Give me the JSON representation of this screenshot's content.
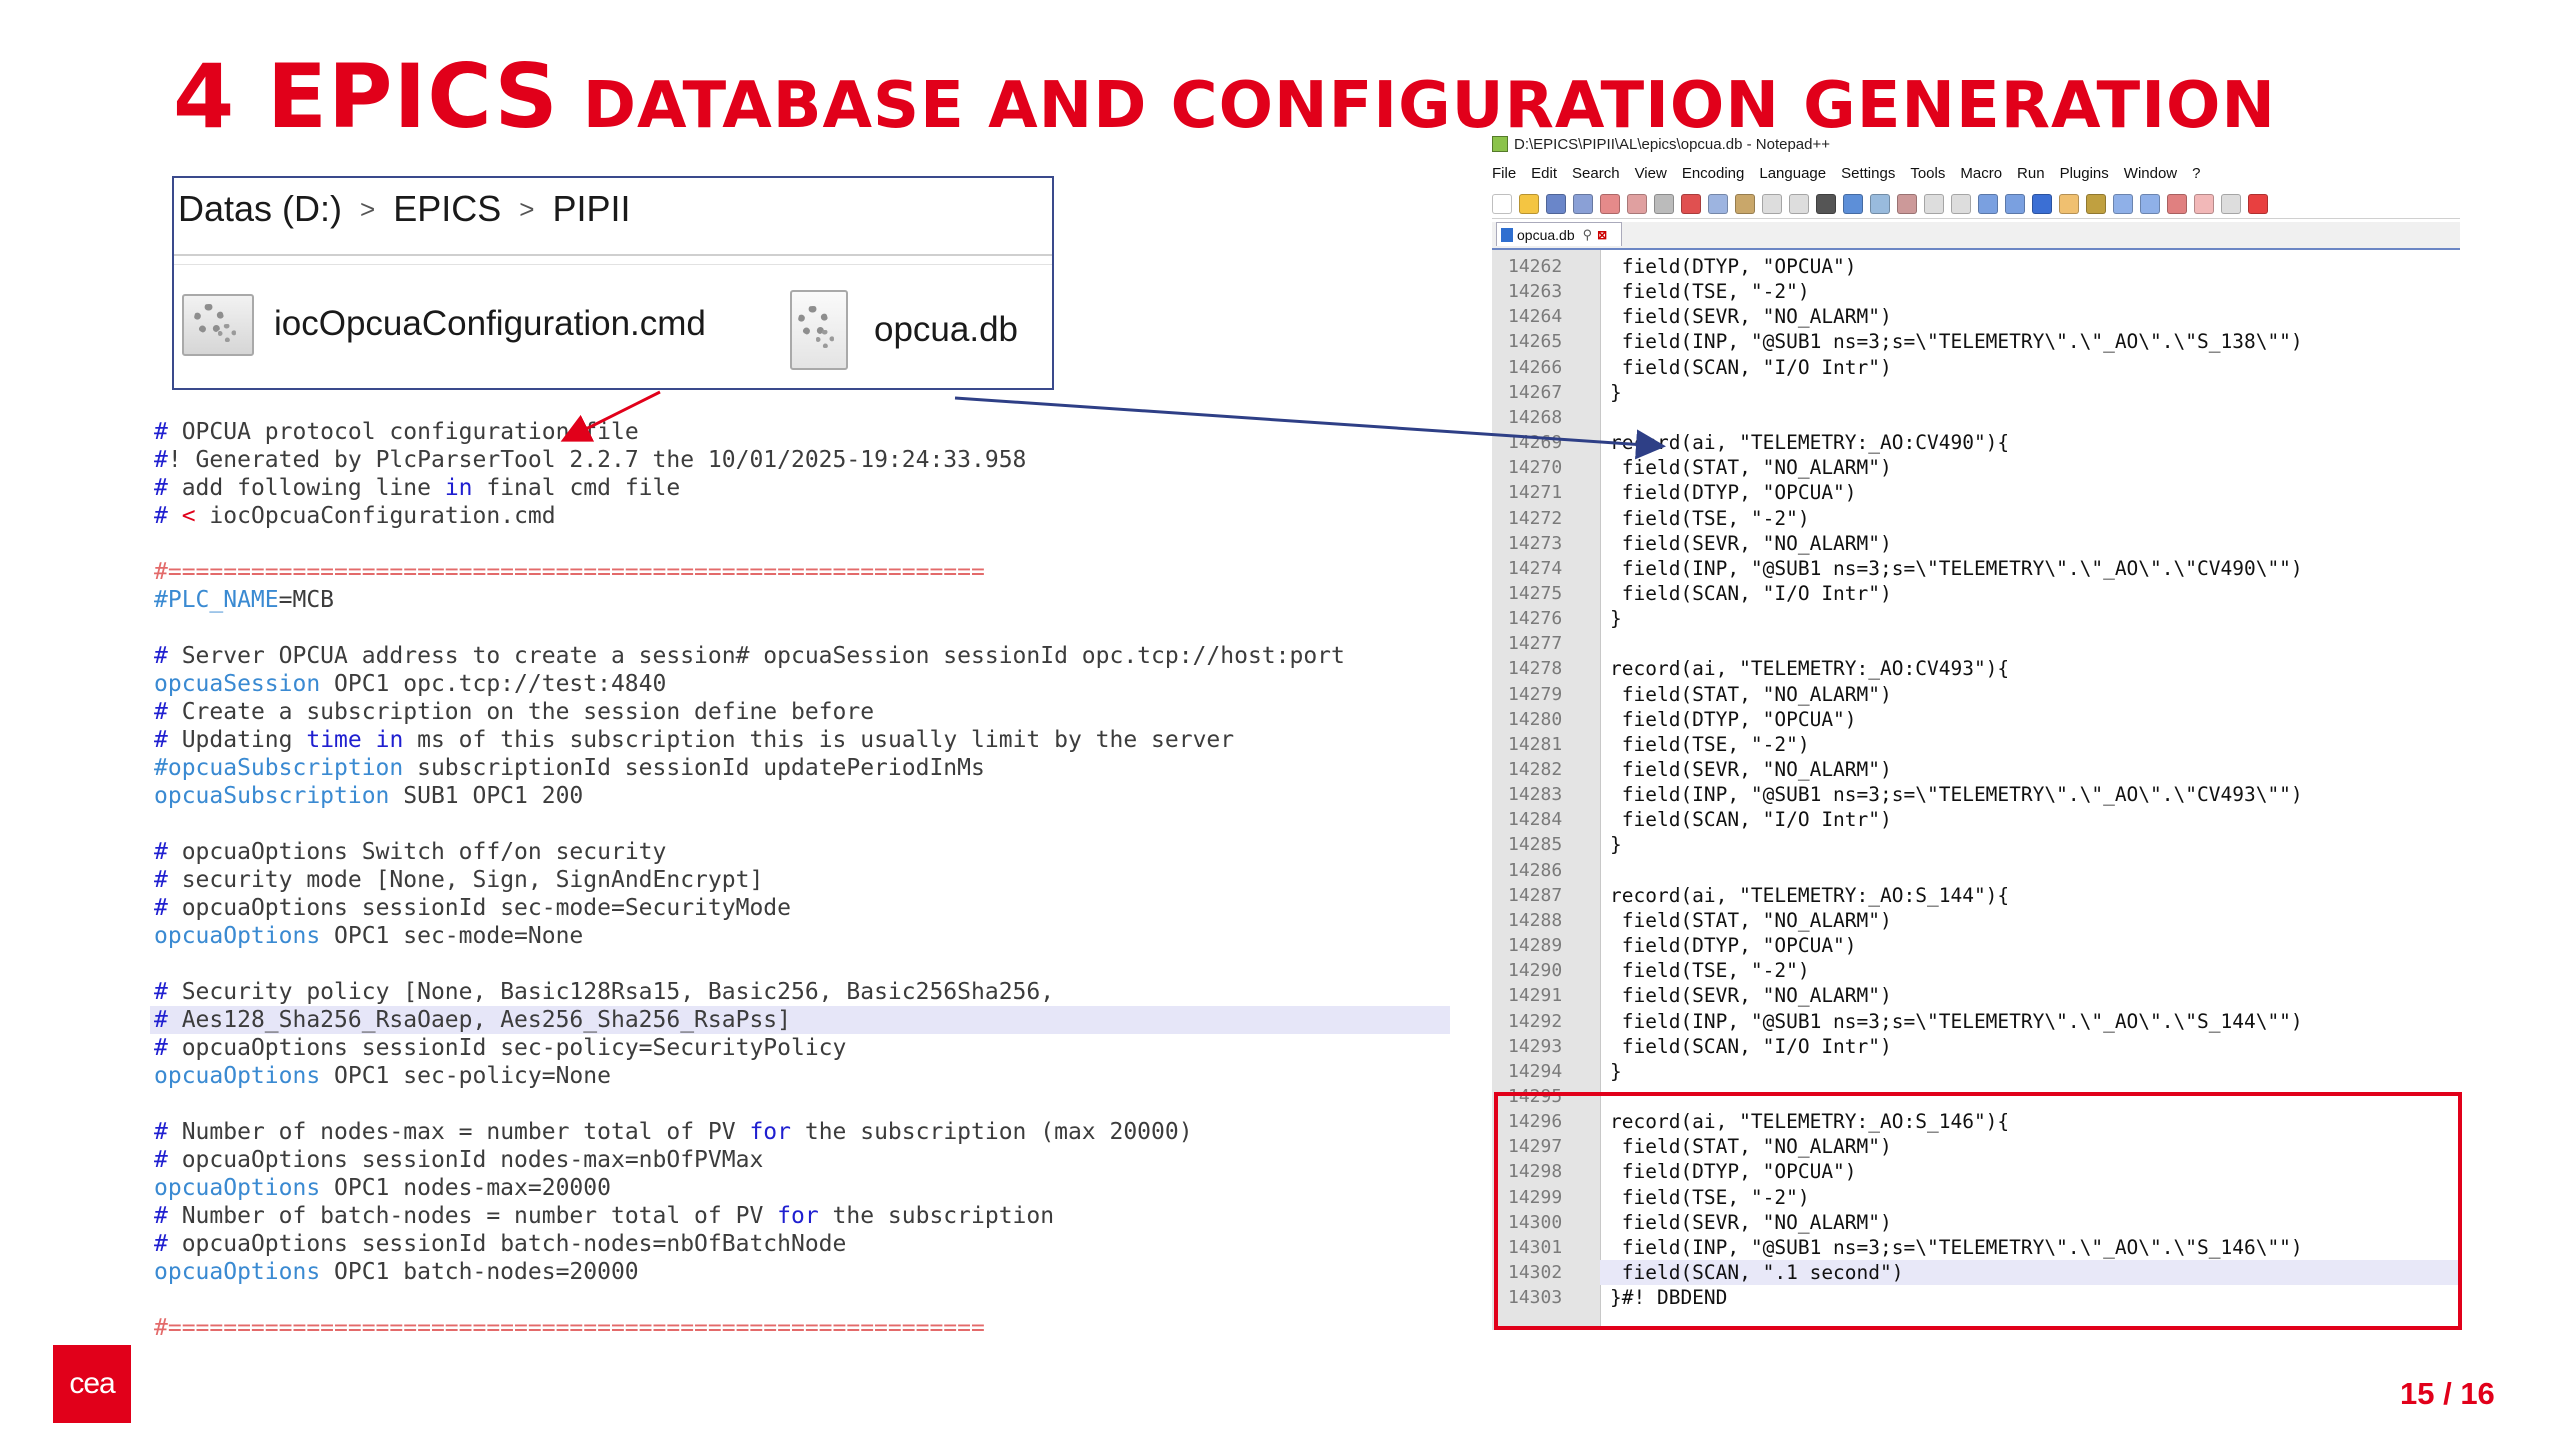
{
  "slide": {
    "title_part1": "4 EPICS",
    "title_part2": "DATABASE AND CONFIGURATION GENERATION",
    "page_number": "15 / 16",
    "logo_text": "cea",
    "accent_color": "#e1001a"
  },
  "explorer": {
    "breadcrumb": [
      "Datas (D:)",
      "EPICS",
      "PIPII"
    ],
    "breadcrumb_separator": ">",
    "files": [
      {
        "name": "iocOpcuaConfiguration.cmd",
        "icon": "settings-file-icon"
      },
      {
        "name": "opcua.db",
        "icon": "settings-document-icon"
      }
    ]
  },
  "config_file": {
    "lines": [
      "# OPCUA protocol configuration file",
      "#! Generated by PlcParserTool 2.2.7 the 10/01/2025-19:24:33.958",
      "# add following line in final cmd file",
      "# < iocOpcuaConfiguration.cmd",
      "",
      "#===========================================================",
      "#PLC_NAME=MCB",
      "",
      "# Server OPCUA address to create a session# opcuaSession sessionId opc.tcp://host:port",
      "opcuaSession OPC1 opc.tcp://test:4840",
      "# Create a subscription on the session define before",
      "# Updating time in ms of this subscription this is usually limit by the server",
      "#opcuaSubscription subscriptionId sessionId updatePeriodInMs",
      "opcuaSubscription SUB1 OPC1 200",
      "",
      "# opcuaOptions Switch off/on security",
      "# security mode [None, Sign, SignAndEncrypt]",
      "# opcuaOptions sessionId sec-mode=SecurityMode",
      "opcuaOptions OPC1 sec-mode=None",
      "",
      "# Security policy [None, Basic128Rsa15, Basic256, Basic256Sha256,",
      "# Aes128_Sha256_RsaOaep, Aes256_Sha256_RsaPss]",
      "# opcuaOptions sessionId sec-policy=SecurityPolicy",
      "opcuaOptions OPC1 sec-policy=None",
      "",
      "# Number of nodes-max = number total of PV for the subscription (max 20000)",
      "# opcuaOptions sessionId nodes-max=nbOfPVMax",
      "opcuaOptions OPC1 nodes-max=20000",
      "# Number of batch-nodes = number total of PV for the subscription",
      "# opcuaOptions sessionId batch-nodes=nbOfBatchNode",
      "opcuaOptions OPC1 batch-nodes=20000",
      "",
      "#==========================================================="
    ]
  },
  "notepad": {
    "window_title": "D:\\EPICS\\PIPII\\AL\\epics\\opcua.db - Notepad++",
    "menu": [
      "File",
      "Edit",
      "Search",
      "View",
      "Encoding",
      "Language",
      "Settings",
      "Tools",
      "Macro",
      "Run",
      "Plugins",
      "Window",
      "?"
    ],
    "tab_label": "opcua.db",
    "lines": [
      {
        "n": "14262",
        "t": " field(DTYP, \"OPCUA\")"
      },
      {
        "n": "14263",
        "t": " field(TSE, \"-2\")"
      },
      {
        "n": "14264",
        "t": " field(SEVR, \"NO_ALARM\")"
      },
      {
        "n": "14265",
        "t": " field(INP, \"@SUB1 ns=3;s=\\\"TELEMETRY\\\".\\\"_AO\\\".\\\"S_138\\\"\")"
      },
      {
        "n": "14266",
        "t": " field(SCAN, \"I/O Intr\")"
      },
      {
        "n": "14267",
        "t": "}"
      },
      {
        "n": "14268",
        "t": ""
      },
      {
        "n": "14269",
        "t": "record(ai, \"TELEMETRY:_AO:CV490\"){"
      },
      {
        "n": "14270",
        "t": " field(STAT, \"NO_ALARM\")"
      },
      {
        "n": "14271",
        "t": " field(DTYP, \"OPCUA\")"
      },
      {
        "n": "14272",
        "t": " field(TSE, \"-2\")"
      },
      {
        "n": "14273",
        "t": " field(SEVR, \"NO_ALARM\")"
      },
      {
        "n": "14274",
        "t": " field(INP, \"@SUB1 ns=3;s=\\\"TELEMETRY\\\".\\\"_AO\\\".\\\"CV490\\\"\")"
      },
      {
        "n": "14275",
        "t": " field(SCAN, \"I/O Intr\")"
      },
      {
        "n": "14276",
        "t": "}"
      },
      {
        "n": "14277",
        "t": ""
      },
      {
        "n": "14278",
        "t": "record(ai, \"TELEMETRY:_AO:CV493\"){"
      },
      {
        "n": "14279",
        "t": " field(STAT, \"NO_ALARM\")"
      },
      {
        "n": "14280",
        "t": " field(DTYP, \"OPCUA\")"
      },
      {
        "n": "14281",
        "t": " field(TSE, \"-2\")"
      },
      {
        "n": "14282",
        "t": " field(SEVR, \"NO_ALARM\")"
      },
      {
        "n": "14283",
        "t": " field(INP, \"@SUB1 ns=3;s=\\\"TELEMETRY\\\".\\\"_AO\\\".\\\"CV493\\\"\")"
      },
      {
        "n": "14284",
        "t": " field(SCAN, \"I/O Intr\")"
      },
      {
        "n": "14285",
        "t": "}"
      },
      {
        "n": "14286",
        "t": ""
      },
      {
        "n": "14287",
        "t": "record(ai, \"TELEMETRY:_AO:S_144\"){"
      },
      {
        "n": "14288",
        "t": " field(STAT, \"NO_ALARM\")"
      },
      {
        "n": "14289",
        "t": " field(DTYP, \"OPCUA\")"
      },
      {
        "n": "14290",
        "t": " field(TSE, \"-2\")"
      },
      {
        "n": "14291",
        "t": " field(SEVR, \"NO_ALARM\")"
      },
      {
        "n": "14292",
        "t": " field(INP, \"@SUB1 ns=3;s=\\\"TELEMETRY\\\".\\\"_AO\\\".\\\"S_144\\\"\")"
      },
      {
        "n": "14293",
        "t": " field(SCAN, \"I/O Intr\")"
      },
      {
        "n": "14294",
        "t": "}"
      },
      {
        "n": "14295",
        "t": ""
      },
      {
        "n": "14296",
        "t": "record(ai, \"TELEMETRY:_AO:S_146\"){"
      },
      {
        "n": "14297",
        "t": " field(STAT, \"NO_ALARM\")"
      },
      {
        "n": "14298",
        "t": " field(DTYP, \"OPCUA\")"
      },
      {
        "n": "14299",
        "t": " field(TSE, \"-2\")"
      },
      {
        "n": "14300",
        "t": " field(SEVR, \"NO_ALARM\")"
      },
      {
        "n": "14301",
        "t": " field(INP, \"@SUB1 ns=3;s=\\\"TELEMETRY\\\".\\\"_AO\\\".\\\"S_146\\\"\")"
      },
      {
        "n": "14302",
        "t": " field(SCAN, \".1 second\")"
      },
      {
        "n": "14303",
        "t": "}#! DBDEND"
      }
    ]
  }
}
